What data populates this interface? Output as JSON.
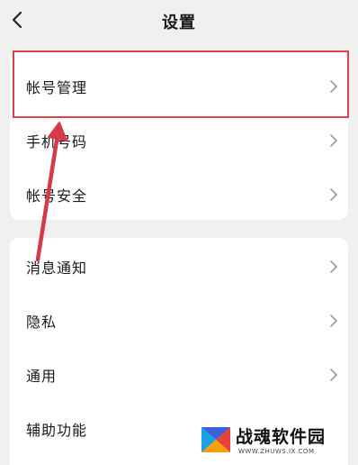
{
  "header": {
    "title": "设置",
    "back_icon": "chevron-left-icon"
  },
  "group1": {
    "items": [
      {
        "label": "帐号管理"
      },
      {
        "label": "手机号码"
      },
      {
        "label": "帐号安全"
      }
    ]
  },
  "group2": {
    "items": [
      {
        "label": "消息通知"
      },
      {
        "label": "隐私"
      },
      {
        "label": "通用"
      },
      {
        "label": "辅助功能"
      }
    ]
  },
  "annotation": {
    "highlight_color": "#e0424c",
    "arrow_color": "#d63a4a"
  },
  "watermark": {
    "name": "战魂软件园",
    "url": "WWW.ZHUWS.IX.COM"
  }
}
